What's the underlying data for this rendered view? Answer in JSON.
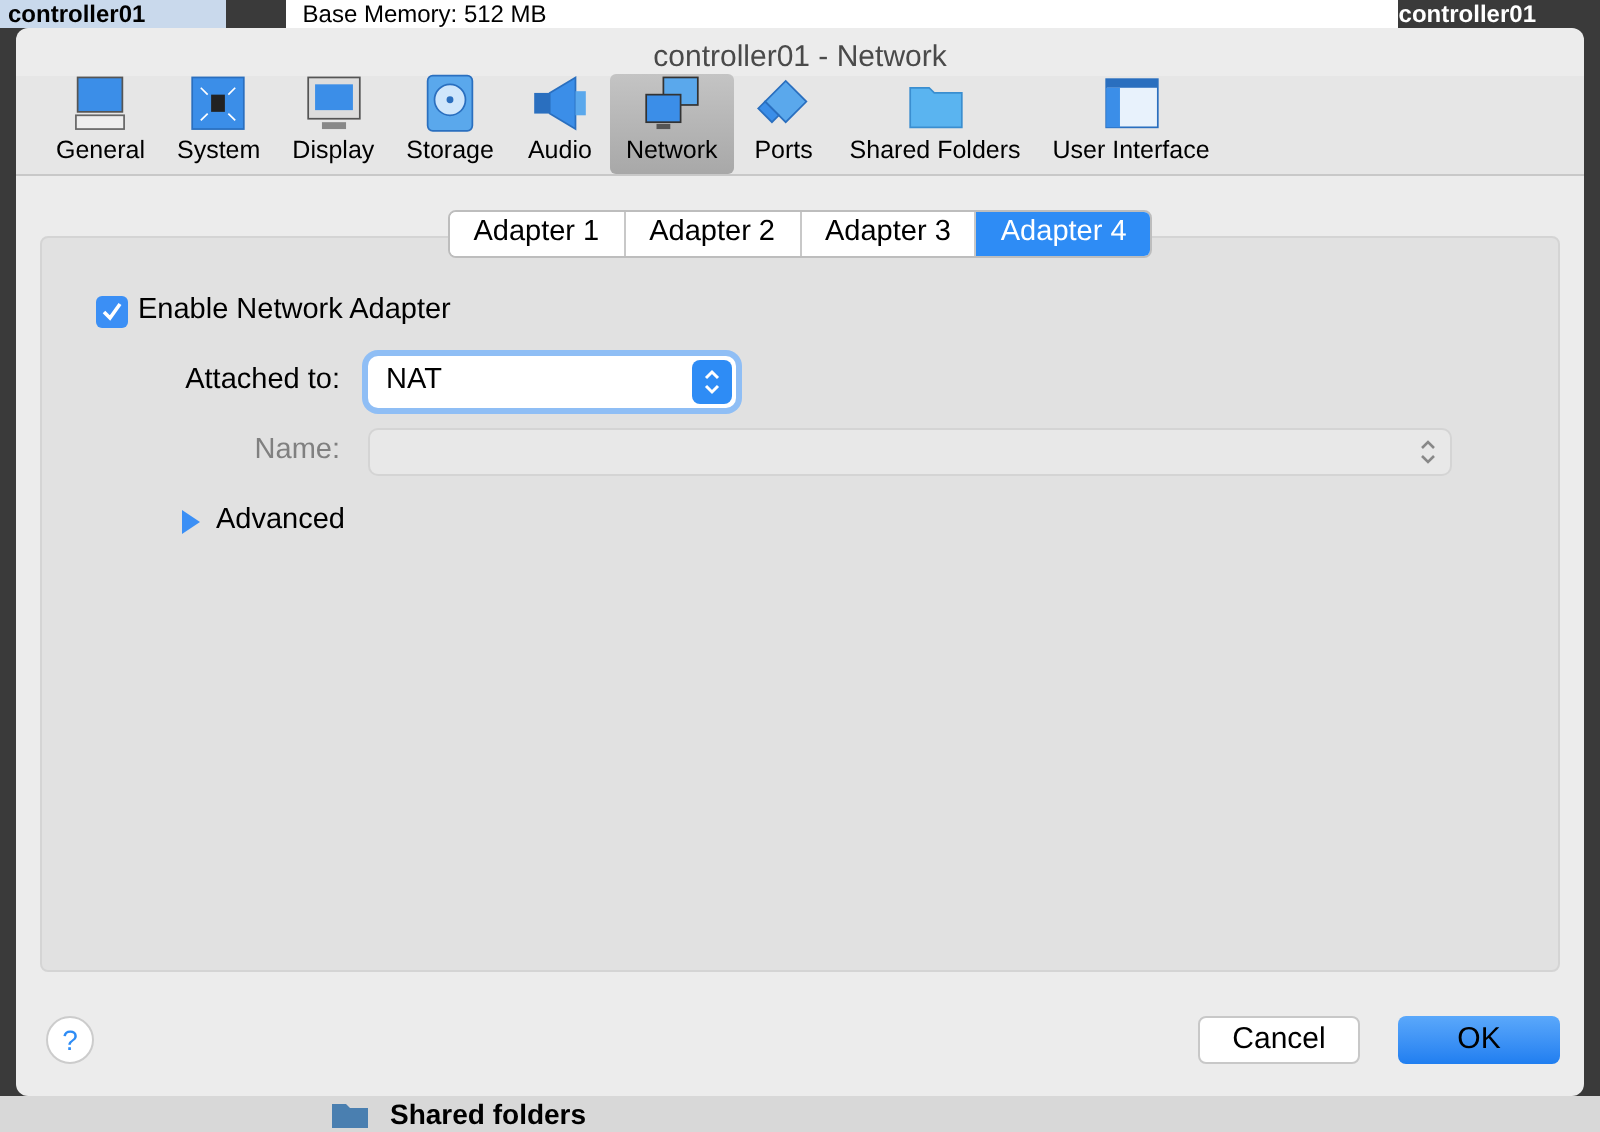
{
  "background": {
    "left_title": "controller01",
    "memory": "Base Memory:   512 MB",
    "right_title": "controller01",
    "bottom_section": "Shared folders"
  },
  "window": {
    "title": "controller01 - Network"
  },
  "toolbar": [
    {
      "label": "General",
      "kind": "general",
      "selected": false
    },
    {
      "label": "System",
      "kind": "system",
      "selected": false
    },
    {
      "label": "Display",
      "kind": "display",
      "selected": false
    },
    {
      "label": "Storage",
      "kind": "storage",
      "selected": false
    },
    {
      "label": "Audio",
      "kind": "audio",
      "selected": false
    },
    {
      "label": "Network",
      "kind": "network",
      "selected": true
    },
    {
      "label": "Ports",
      "kind": "ports",
      "selected": false
    },
    {
      "label": "Shared Folders",
      "kind": "folder",
      "selected": false
    },
    {
      "label": "User Interface",
      "kind": "ui",
      "selected": false
    }
  ],
  "tabs": [
    {
      "label": "Adapter 1",
      "selected": false
    },
    {
      "label": "Adapter 2",
      "selected": false
    },
    {
      "label": "Adapter 3",
      "selected": false
    },
    {
      "label": "Adapter 4",
      "selected": true
    }
  ],
  "enable_adapter": {
    "label": "Enable Network Adapter",
    "checked": true
  },
  "attached_to": {
    "label": "Attached to:",
    "value": "NAT",
    "disabled": false
  },
  "name": {
    "label": "Name:",
    "disabled": true
  },
  "advanced": {
    "label": "Advanced",
    "expanded": false
  },
  "help": {
    "label": "?"
  },
  "buttons": [
    {
      "label": "Cancel",
      "kind": "secondary"
    },
    {
      "label": "OK",
      "kind": "primary"
    }
  ]
}
